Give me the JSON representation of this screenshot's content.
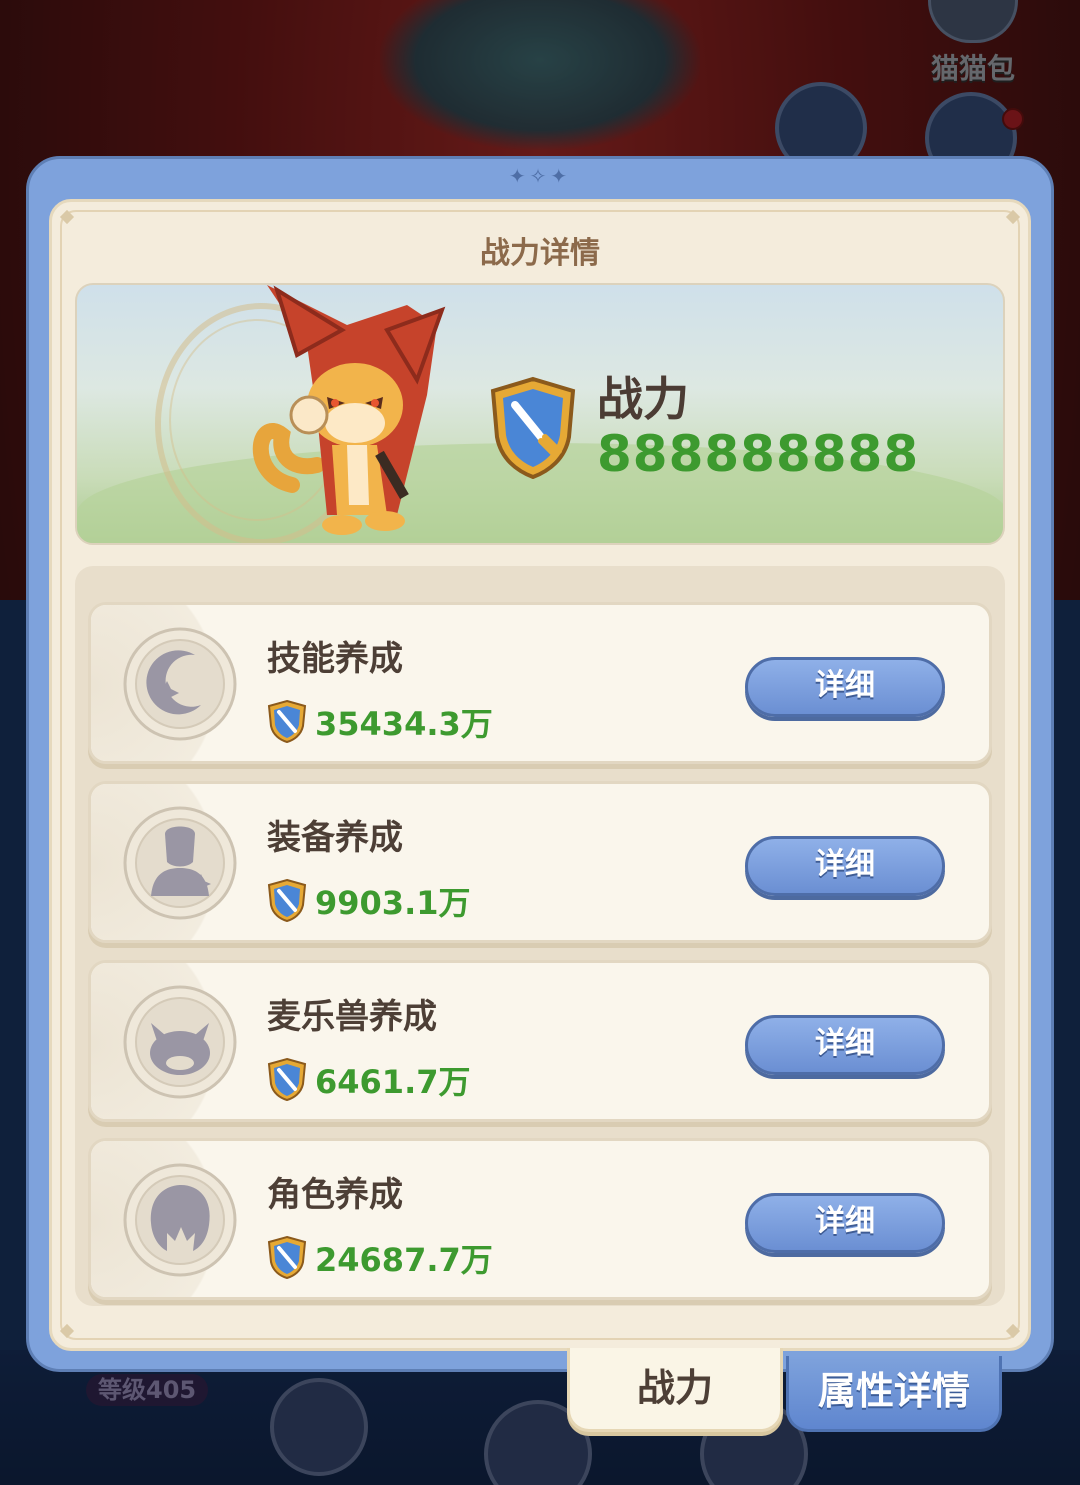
{
  "background": {
    "top_right_button_label": "猫猫包",
    "level_badge": "等级405"
  },
  "modal": {
    "title": "战力详情",
    "hero": {
      "power_label": "战力",
      "power_value": "888888888"
    },
    "items": [
      {
        "name": "技能养成",
        "value": "35434.3万",
        "button": "详细",
        "icon": "moon-star-icon"
      },
      {
        "name": "装备养成",
        "value": "9903.1万",
        "button": "详细",
        "icon": "equipment-bust-icon"
      },
      {
        "name": "麦乐兽养成",
        "value": "6461.7万",
        "button": "详细",
        "icon": "cat-face-icon"
      },
      {
        "name": "角色养成",
        "value": "24687.7万",
        "button": "详细",
        "icon": "character-head-icon"
      }
    ]
  },
  "tabs": [
    {
      "label": "战力",
      "active": true
    },
    {
      "label": "属性详情",
      "active": false
    }
  ],
  "colors": {
    "accent_blue": "#7ea2dc",
    "power_green": "#3d9a2f",
    "panel_cream": "#f4ecdc"
  }
}
